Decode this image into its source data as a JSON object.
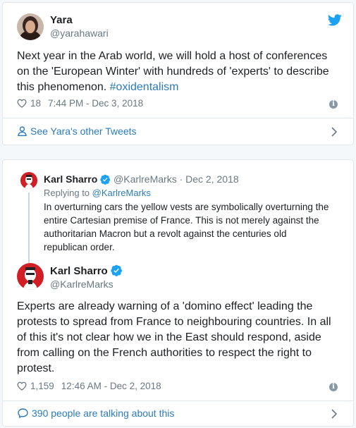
{
  "tweet1": {
    "name": "Yara",
    "handle": "@yarahawari",
    "text_main": "Next year in the Arab world, we will hold a host of conferences on the 'European Winter' with hundreds of 'experts' to describe this phenomenon. ",
    "hashtag": "#oxidentalism",
    "likes": "18",
    "timestamp": "7:44 PM - Dec 3, 2018",
    "footer": "See Yara's other Tweets"
  },
  "tweet2": {
    "parent": {
      "name": "Karl Sharro",
      "handle": "@KarlreMarks",
      "date": "· Dec 2, 2018",
      "replying_prefix": "Replying to ",
      "replying_handle": "@KarlreMarks",
      "text": "In overturning cars the yellow vests are symbolically overturning the entire Cartesian premise of France. This is not merely against the authoritarian Macron but a revolt against the centuries old republican order."
    },
    "name": "Karl Sharro",
    "handle": "@KarlreMarks",
    "text": "Experts are already warning of a 'domino effect' leading the protests to spread from France to neighbouring countries. In all of this it's not clear how we in the East should respond, aside from calling on the French authorities to respect the right to protest.",
    "likes": "1,159",
    "timestamp": "12:46 AM - Dec 2, 2018",
    "footer": "390 people are talking about this"
  },
  "icons": {
    "bird": "twitter-bird-icon",
    "heart": "heart-icon",
    "info": "info-icon",
    "person": "person-icon",
    "comment": "comment-bubble-icon",
    "chevron": "chevron-right-icon",
    "verified": "verified-badge-icon"
  },
  "colors": {
    "link": "#2b7bb9",
    "twitter_blue": "#1da1f2",
    "muted": "#697882",
    "border": "#e1e8ed"
  }
}
